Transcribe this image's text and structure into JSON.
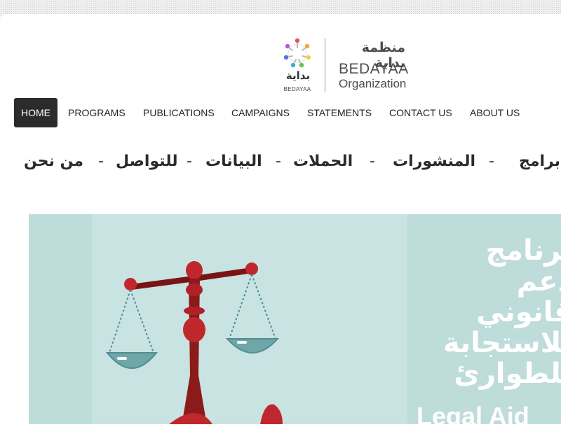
{
  "logo": {
    "ar_name": "منظمة بداية",
    "en_name": "BEDAYAA",
    "en_sub": "Organization",
    "mark_ar": "بداية",
    "mark_en": "BEDAYAA"
  },
  "nav": {
    "items": [
      {
        "label": "HOME",
        "active": true
      },
      {
        "label": "PROGRAMS"
      },
      {
        "label": "PUBLICATIONS"
      },
      {
        "label": "CAMPAIGNS"
      },
      {
        "label": "STATEMENTS"
      },
      {
        "label": "CONTACT US"
      },
      {
        "label": "ABOUT US"
      }
    ]
  },
  "ar_nav": {
    "items": [
      "برامج",
      "المنشورات",
      "الحملات",
      "البيانات",
      "للتواصل",
      "من نحن"
    ],
    "separator": "-"
  },
  "banner": {
    "ar_lines": [
      "برنامج",
      "دعم",
      "قانوني",
      "للاستجابة",
      "للطوارئ"
    ],
    "en_title": "Legal Aid"
  },
  "colors": {
    "nav_active_bg": "#2b2b2b",
    "banner_bg": "#bedcda",
    "scale_red": "#8b1a1a",
    "pan_color": "#6fa7a8"
  }
}
